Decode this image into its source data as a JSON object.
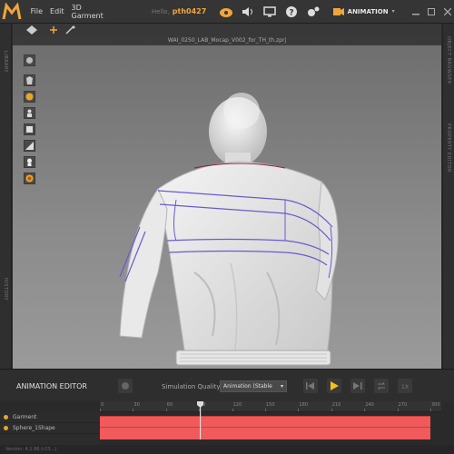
{
  "menu": {
    "items": [
      "File",
      "Edit",
      "3D Garment"
    ],
    "hello": "Hello,",
    "username": "pth0427",
    "mode": "ANIMATION"
  },
  "rails": {
    "left_top": "LIBRARY",
    "left_bottom": "HISTORY",
    "right_top": "OBJECT BROWSER",
    "right_bottom": "PROPERTY EDITOR"
  },
  "viewport": {
    "file_title": "WAI_0250_LAB_Mocap_V002_for_TH_th.zprj"
  },
  "animation_editor": {
    "title": "ANIMATION EDITOR",
    "sim_quality_label": "Simulation Quality",
    "sim_quality_value": "Animation (Stable",
    "ruler_ticks": [
      "0",
      "30",
      "60",
      "90",
      "120",
      "150",
      "180",
      "210",
      "240",
      "270",
      "300"
    ],
    "tracks": [
      {
        "name": "Garment"
      },
      {
        "name": "Sphere_1Shape"
      }
    ],
    "status": "Version: 4.1.86 (r23...)"
  },
  "colors": {
    "accent": "#f0a63a",
    "track": "#f05a5a",
    "play": "#f5c21b"
  }
}
